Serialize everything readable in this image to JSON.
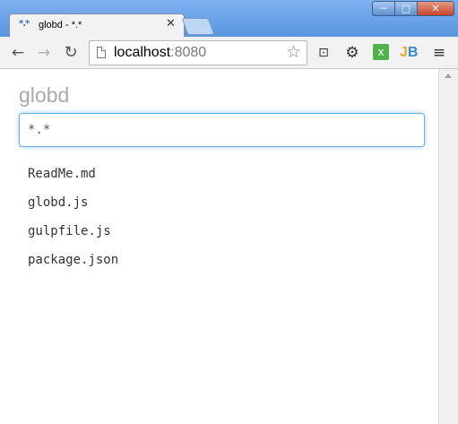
{
  "window": {
    "controls": {
      "minimize": "─",
      "maximize": "□",
      "close": "✕"
    }
  },
  "tab": {
    "favicon": "*.*",
    "title": "globd - *.*",
    "close": "✕"
  },
  "toolbar": {
    "back": "←",
    "forward": "→",
    "reload": "↻",
    "url_host": "localhost",
    "url_port": ":8080",
    "star": "☆",
    "cast": "⊡",
    "gear": "⚙",
    "ext_green": "x",
    "ext_jb_j": "J",
    "ext_jb_b": "B",
    "menu": "≡"
  },
  "app": {
    "title": "globd",
    "search_value": "*.*",
    "files": [
      "ReadMe.md",
      "globd.js",
      "gulpfile.js",
      "package.json"
    ]
  }
}
